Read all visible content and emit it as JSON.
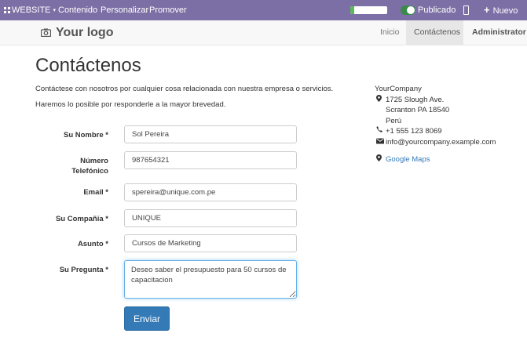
{
  "adminbar": {
    "website_label": "WEBSITE",
    "contenido": "Contenido",
    "personalizar": "Personalizar",
    "promover": "Promover",
    "seo_progress": 0.1,
    "publicado": "Publicado",
    "nuevo": "Nuevo"
  },
  "navbar": {
    "logo": "Your logo",
    "inicio": "Inicio",
    "contactenos": "Contáctenos",
    "administrator": "Administrator"
  },
  "page": {
    "title": "Contáctenos",
    "intro1": "Contáctese con nosotros por cualquier cosa relacionada con nuestra empresa o servicios.",
    "intro2": "Haremos lo posible por responderle a la mayor brevedad."
  },
  "form": {
    "name_label": "Su Nombre *",
    "name_value": "Sol Pereira",
    "phone_label_1": "Número",
    "phone_label_2": "Telefónico",
    "phone_value": "987654321",
    "email_label": "Email *",
    "email_value": "spereira@unique.com.pe",
    "company_label": "Su Compañía *",
    "company_value": "UNIQUE",
    "subject_label": "Asunto *",
    "subject_value": "Cursos de Marketing",
    "question_label": "Su Pregunta *",
    "question_value": "Deseo saber el presupuesto para 50 cursos de capacitacion",
    "submit": "Enviar"
  },
  "company": {
    "name": "YourCompany",
    "address1": "1725 Slough Ave.",
    "address2": "Scranton PA 18540",
    "address3": "Perú",
    "phone": "+1 555 123 8069",
    "email": "info@yourcompany.example.com",
    "maps": "Google Maps"
  },
  "icons": [
    "grid-icon",
    "mobile-icon",
    "plus-icon",
    "camera-icon",
    "map-marker-icon",
    "phone-icon",
    "envelope-icon"
  ]
}
